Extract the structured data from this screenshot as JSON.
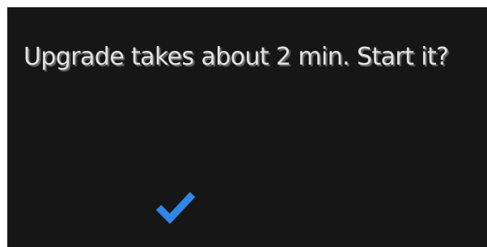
{
  "dialog": {
    "message": "Upgrade takes about 2 min. Start it?",
    "confirm": {
      "icon": "checkmark-icon",
      "color": "#2f86e8"
    }
  },
  "colors": {
    "background": "#161616",
    "text": "#e2e2e2",
    "text_shadow": "#6a6a6a",
    "accent": "#2f86e8"
  }
}
